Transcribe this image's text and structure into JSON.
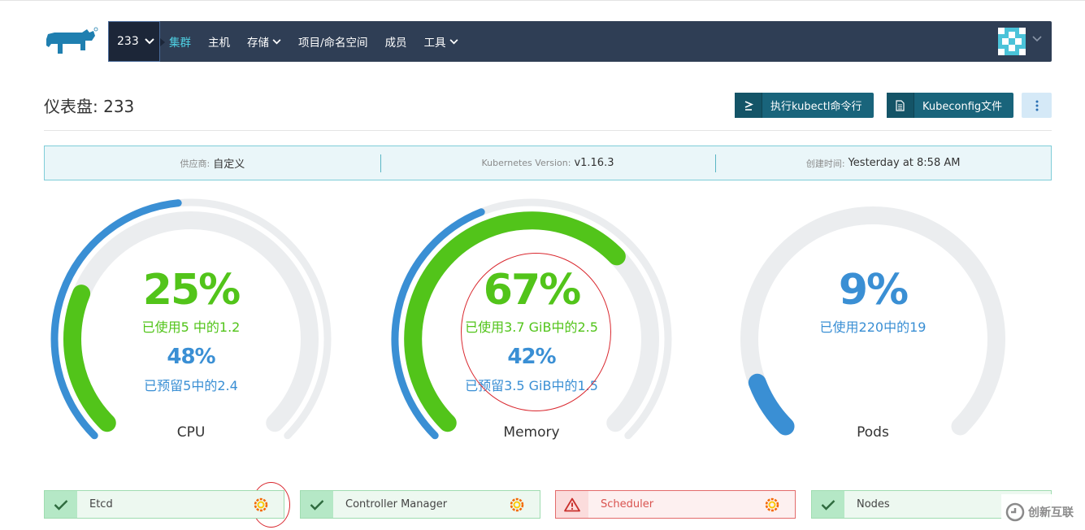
{
  "navbar": {
    "cluster": "233",
    "items": [
      {
        "label": "集群",
        "active": true,
        "dropdown": false
      },
      {
        "label": "主机",
        "active": false,
        "dropdown": false
      },
      {
        "label": "存储",
        "active": false,
        "dropdown": true
      },
      {
        "label": "项目/命名空间",
        "active": false,
        "dropdown": false
      },
      {
        "label": "成员",
        "active": false,
        "dropdown": false
      },
      {
        "label": "工具",
        "active": false,
        "dropdown": true
      }
    ]
  },
  "header": {
    "title": "仪表盘: 233",
    "kubectl_button": "执行kubectl命令行",
    "kubeconfig_button": "Kubeconfig文件"
  },
  "info": {
    "provider_key": "供应商:",
    "provider_val": "自定义",
    "version_key": "Kubernetes Version:",
    "version_val": "v1.16.3",
    "created_key": "创建时间:",
    "created_val": "Yesterday at 8:58 AM"
  },
  "gauges": {
    "cpu": {
      "used_percent": "25%",
      "used_text": "已使用5 中的1.2",
      "used_fraction": 0.25,
      "reserved_percent": "48%",
      "reserved_text": "已预留5中的2.4",
      "reserved_fraction": 0.48,
      "name": "CPU"
    },
    "memory": {
      "used_percent": "67%",
      "used_text": "已使用3.7 GiB中的2.5",
      "used_fraction": 0.67,
      "reserved_percent": "42%",
      "reserved_text": "已预留3.5 GiB中的1.5",
      "reserved_fraction": 0.42,
      "name": "Memory"
    },
    "pods": {
      "used_percent": "9%",
      "used_text": "已使用220中的19",
      "used_fraction": 0.09,
      "name": "Pods"
    }
  },
  "components": [
    {
      "name": "Etcd",
      "status": "ok"
    },
    {
      "name": "Controller Manager",
      "status": "ok"
    },
    {
      "name": "Scheduler",
      "status": "error"
    },
    {
      "name": "Nodes",
      "status": "ok"
    }
  ],
  "watermark": "创新互联",
  "colors": {
    "nav_bg": "#2f3e55",
    "nav_active": "#4fd0e3",
    "used_green": "#52c41a",
    "reserved_blue": "#3a8fd4",
    "track_gray": "#ebedef",
    "button_teal": "#19647b",
    "annotation_red": "#d9272e"
  },
  "icons": {
    "logo": "rancher-cow-logo",
    "ok": "check-icon",
    "error": "warning-triangle-icon",
    "grafana": "grafana-icon",
    "kubectl": "terminal-icon",
    "kubeconfig": "file-icon",
    "more": "vertical-dots-icon"
  }
}
